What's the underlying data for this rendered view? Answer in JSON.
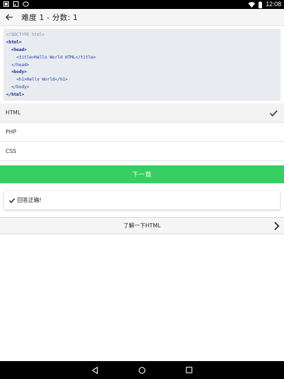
{
  "status_bar": {
    "time": "12:08",
    "icons_left": [
      "notification-icon",
      "image-icon",
      "circle-icon"
    ],
    "icons_right": [
      "wifi-icon",
      "battery-icon"
    ]
  },
  "app_bar": {
    "back_icon": "arrow-left-icon",
    "title": "难度 1 - 分数: 1"
  },
  "code": {
    "lines": [
      "<!DOCTYPE html>",
      "<html>",
      "  <head>",
      "    <title>Hello World HTML</title>",
      "  </head>",
      "  <body>",
      "    <h1>Hello World</h1>",
      "  </body>",
      "</html>"
    ]
  },
  "options": [
    {
      "label": "HTML",
      "selected": true
    },
    {
      "label": "PHP",
      "selected": false
    },
    {
      "label": "CSS",
      "selected": false
    }
  ],
  "next_button": {
    "label": "下一题"
  },
  "result": {
    "text": "回答正确!",
    "icon": "check-icon"
  },
  "learn_more": {
    "label": "了解一下HTML",
    "icon": "chevron-right-icon"
  },
  "nav_bar": {
    "buttons": [
      "back-triangle-icon",
      "home-circle-icon",
      "recents-square-icon"
    ]
  },
  "colors": {
    "accent_green": "#36cf62",
    "code_bg": "#e8ebf0",
    "appbar_bg": "#f5f5f5",
    "tag_blue": "#1a3fa0",
    "doctype_gray": "#7f8fa6"
  }
}
